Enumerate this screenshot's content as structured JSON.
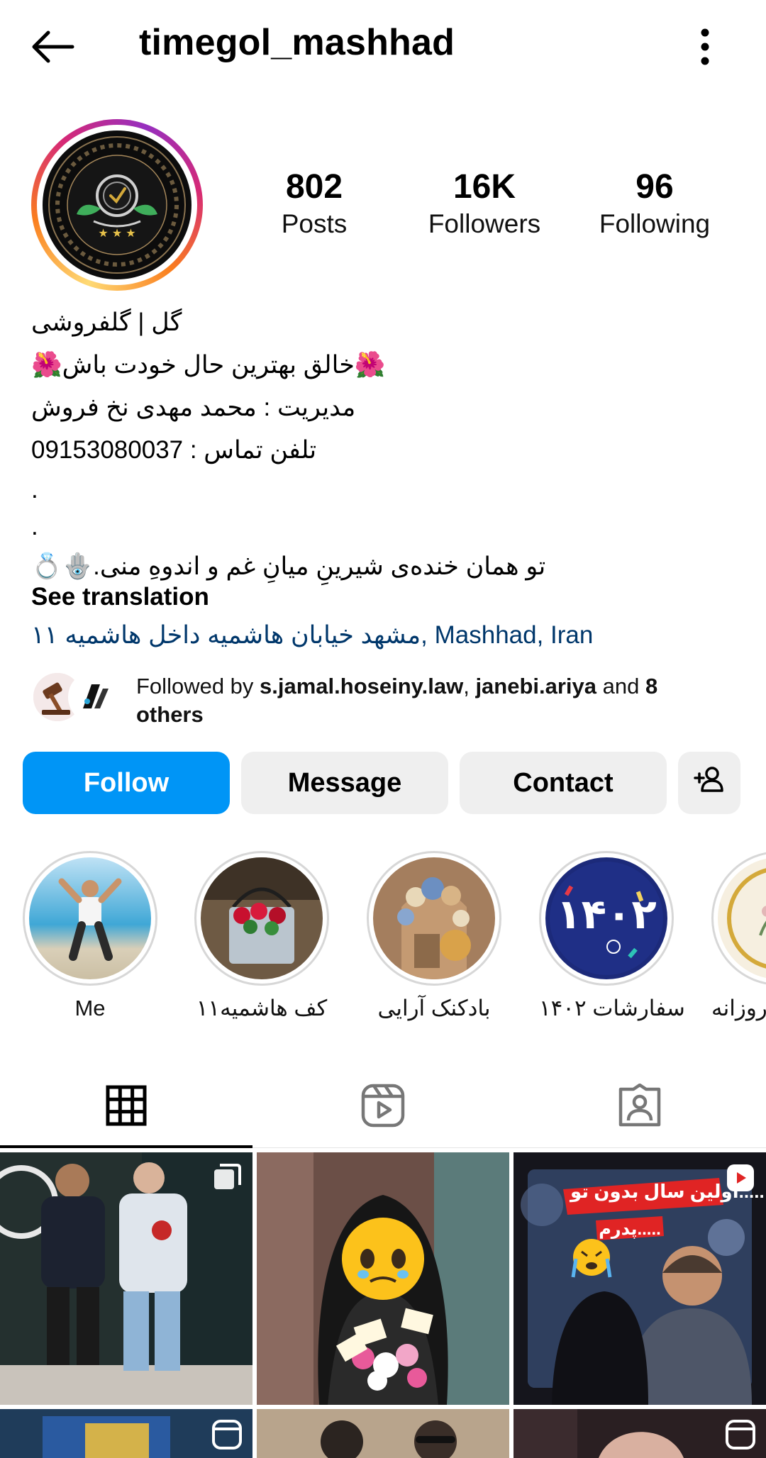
{
  "header": {
    "username": "timegol_mashhad"
  },
  "stats": [
    {
      "value": "802",
      "label": "Posts"
    },
    {
      "value": "16K",
      "label": "Followers"
    },
    {
      "value": "96",
      "label": "Following"
    }
  ],
  "bio": {
    "lines": [
      "گل | گلفروشی",
      "🌺خالق بهترین حال خودت باش🌺",
      "مدیریت : محمد مهدی نخ فروش",
      "تلفن تماس : 09153080037",
      ".",
      ".",
      "💍🪬.تو همان خنده‌ی شیرینِ میانِ غم و اندوهِ منی"
    ],
    "see_translation": "See translation",
    "location": "مشهد خیابان هاشمیه داخل هاشمیه ۱۱, Mashhad, Iran"
  },
  "followed_by": {
    "prefix": "Followed by ",
    "user1": "s.jamal.hoseiny.law",
    "sep": ", ",
    "user2": "janebi.ariya",
    "middle": " and ",
    "others": "8 others"
  },
  "buttons": {
    "follow": "Follow",
    "message": "Message",
    "contact": "Contact"
  },
  "highlights": [
    {
      "label": "Me"
    },
    {
      "label": "کف هاشمیه۱۱"
    },
    {
      "label": "بادکنک آرایی"
    },
    {
      "label": "سفارشات ۱۴۰۲"
    },
    {
      "label": "روزانه"
    }
  ],
  "post_overlays": {
    "post3_caption": "اولین سال بدون تو.....",
    "post3_sub": "پدرم....."
  },
  "icons": {
    "back": "arrow-left-icon",
    "more": "more-vertical-icon",
    "add_user": "add-user-icon",
    "grid": "grid-icon",
    "reels": "reels-icon",
    "tagged": "tagged-icon"
  },
  "colors": {
    "follow": "#0095f6",
    "link": "#00376b",
    "secondary_button": "#efefef"
  }
}
